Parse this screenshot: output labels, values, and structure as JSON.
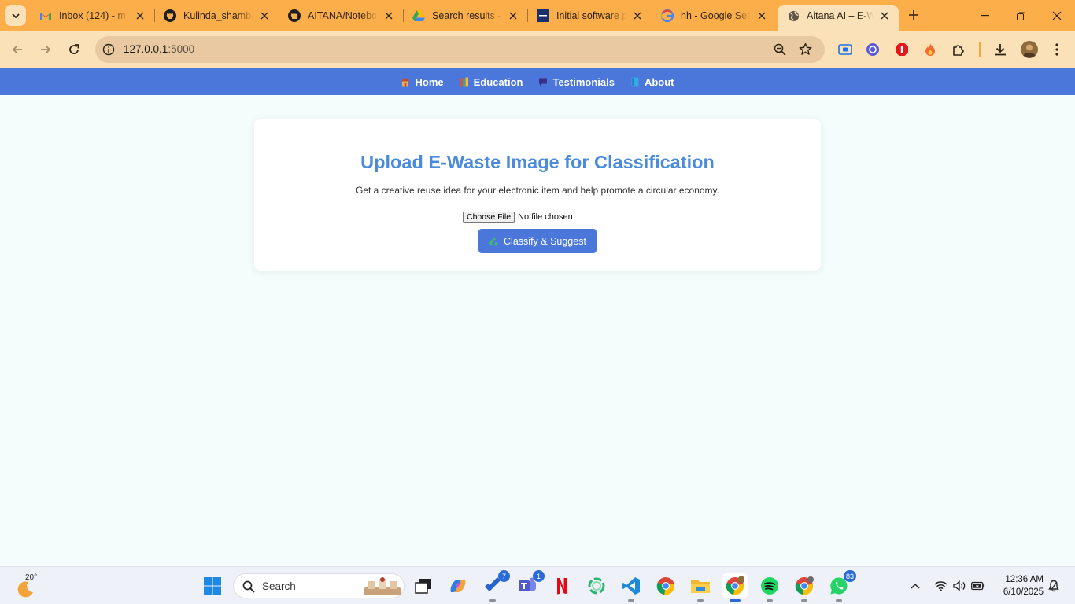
{
  "browser": {
    "tabs": [
      {
        "title": "Inbox (124) - m.y"
      },
      {
        "title": "Kulinda_shamba"
      },
      {
        "title": "AITANA/Notebo"
      },
      {
        "title": "Search results - ‘"
      },
      {
        "title": "Initial software p"
      },
      {
        "title": "hh - Google Sea"
      },
      {
        "title": "Aitana AI – E-Wa",
        "active": true
      }
    ],
    "url_host": "127.0.0.1",
    "url_port": ":5000"
  },
  "nav": {
    "items": [
      {
        "label": "Home",
        "icon": "house-icon"
      },
      {
        "label": "Education",
        "icon": "books-icon"
      },
      {
        "label": "Testimonials",
        "icon": "speech-bubble-icon"
      },
      {
        "label": "About",
        "icon": "book-icon"
      }
    ]
  },
  "main": {
    "title": "Upload E-Waste Image for Classification",
    "subtitle": "Get a creative reuse idea for your electronic item and help promote a circular economy.",
    "file_button": "Choose File",
    "file_status": "No file chosen",
    "submit_label": "Classify & Suggest",
    "submit_icon": "recycle-icon"
  },
  "taskbar": {
    "weather_temp": "20°",
    "search_label": "Search",
    "badges": {
      "todo": "7",
      "teams": "1",
      "whatsapp": "83"
    },
    "time": "12:36 AM",
    "date": "6/10/2025"
  },
  "colors": {
    "tab_strip": "#fcae4a",
    "toolbar": "#fbe1b8",
    "nav_bar": "#4a77d9",
    "heading": "#4a8bdc",
    "page_bg": "#f4fdfb"
  }
}
